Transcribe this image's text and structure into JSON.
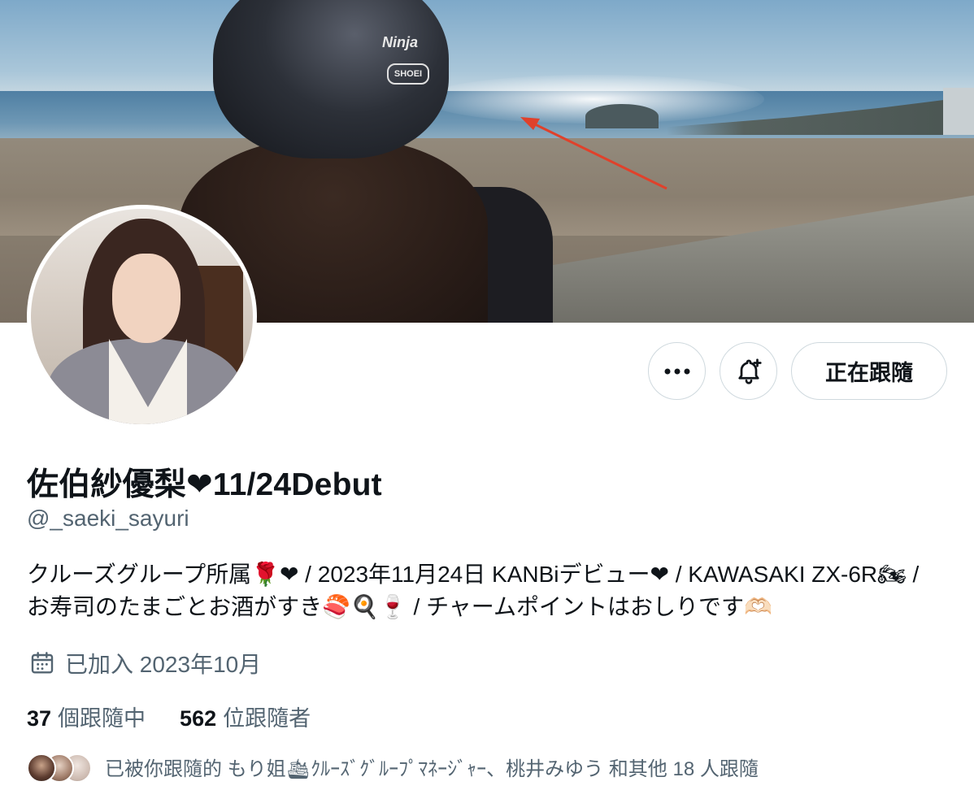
{
  "profile": {
    "display_name": "佐伯紗優梨❤11/24Debut",
    "handle": "@_saeki_sayuri",
    "bio": "クルーズグループ所属🌹❤ / 2023年11月24日 KANBiデビュー❤ / KAWASAKI ZX-6R🏍 / お寿司のたまごとお酒がすき🍣🍳🍷 / チャームポイントはおしりです🫶🏻",
    "joined": "已加入 2023年10月",
    "following_count": "37",
    "following_label": "個跟隨中",
    "followers_count": "562",
    "followers_label": "位跟隨者",
    "followed_by": "已被你跟隨的 もり姐🛳ｸﾙｰｽﾞｸﾞﾙｰﾌﾟﾏﾈｰｼﾞｬｰ、桃井みゆう 和其他 18 人跟隨"
  },
  "actions": {
    "more_label": "•••",
    "follow_label": "正在跟隨"
  },
  "banner": {
    "helmet_brand": "Ninja",
    "helmet_logo": "SHOEI"
  },
  "colors": {
    "text_primary": "#0f1419",
    "text_secondary": "#536471",
    "border": "#cfd9de",
    "arrow": "#e0412b"
  },
  "icons": {
    "more": "more-horizontal-icon",
    "notify": "bell-plus-icon",
    "calendar": "calendar-icon"
  }
}
